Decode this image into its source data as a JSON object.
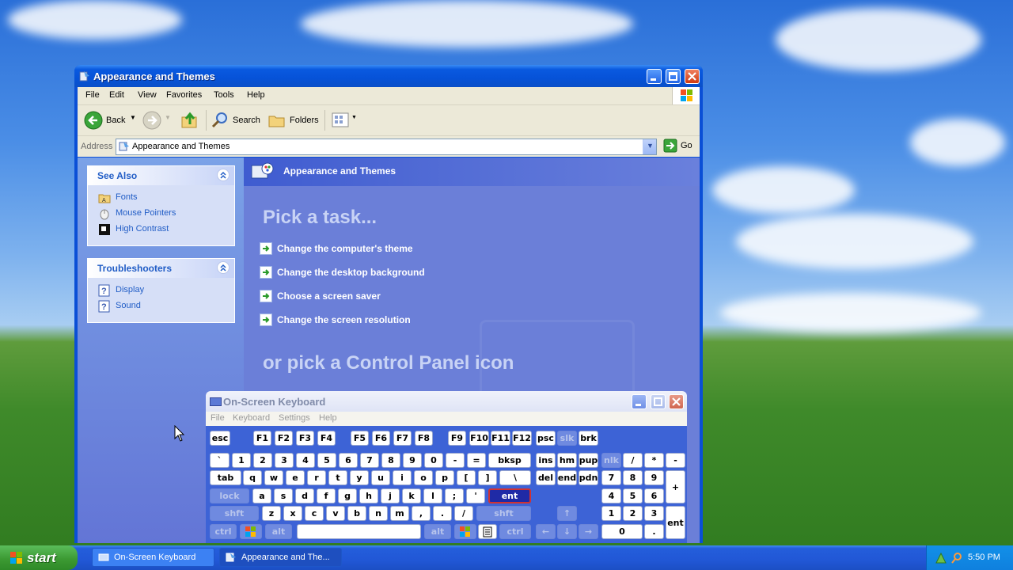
{
  "explorer": {
    "title": "Appearance and Themes",
    "menu": [
      "File",
      "Edit",
      "View",
      "Favorites",
      "Tools",
      "Help"
    ],
    "toolbar": {
      "back": "Back",
      "search": "Search",
      "folders": "Folders"
    },
    "address": {
      "label": "Address",
      "value": "Appearance and Themes",
      "go": "Go"
    },
    "see_also": {
      "title": "See Also",
      "items": [
        "Fonts",
        "Mouse Pointers",
        "High Contrast"
      ]
    },
    "troubleshooters": {
      "title": "Troubleshooters",
      "items": [
        "Display",
        "Sound"
      ]
    },
    "header": "Appearance and Themes",
    "pick_task": "Pick a task...",
    "tasks": [
      "Change the computer's theme",
      "Change the desktop background",
      "Choose a screen saver",
      "Change the screen resolution"
    ],
    "or_pick": "or pick a Control Panel icon"
  },
  "osk": {
    "title": "On-Screen Keyboard",
    "menu": [
      "File",
      "Keyboard",
      "Settings",
      "Help"
    ],
    "keys": {
      "esc": "esc",
      "f1": "F1",
      "f2": "F2",
      "f3": "F3",
      "f4": "F4",
      "f5": "F5",
      "f6": "F6",
      "f7": "F7",
      "f8": "F8",
      "f9": "F9",
      "f10": "F10",
      "f11": "F11",
      "f12": "F12",
      "psc": "psc",
      "slk": "slk",
      "brk": "brk",
      "backtick": "`",
      "n1": "1",
      "n2": "2",
      "n3": "3",
      "n4": "4",
      "n5": "5",
      "n6": "6",
      "n7": "7",
      "n8": "8",
      "n9": "9",
      "n0": "0",
      "minus": "-",
      "equals": "=",
      "bksp": "bksp",
      "ins": "ins",
      "hm": "hm",
      "pup": "pup",
      "nlk": "nlk",
      "np_slash": "/",
      "np_star": "*",
      "np_minus": "-",
      "tab": "tab",
      "q": "q",
      "w": "w",
      "e": "e",
      "r": "r",
      "t": "t",
      "y": "y",
      "u": "u",
      "i": "i",
      "o": "o",
      "p": "p",
      "lbracket": "[",
      "rbracket": "]",
      "backslash": "\\",
      "del": "del",
      "end": "end",
      "pdn": "pdn",
      "np7": "7",
      "np8": "8",
      "np9": "9",
      "np_plus": "+",
      "lock": "lock",
      "a": "a",
      "s": "s",
      "d": "d",
      "f": "f",
      "g": "g",
      "h": "h",
      "j": "j",
      "k": "k",
      "l": "l",
      "semicolon": ";",
      "quote": "'",
      "ent": "ent",
      "np4": "4",
      "np5": "5",
      "np6": "6",
      "lshft": "shft",
      "z": "z",
      "x": "x",
      "c": "c",
      "v": "v",
      "b": "b",
      "n": "n",
      "m": "m",
      "comma": ",",
      "period": ".",
      "slash": "/",
      "rshft": "shft",
      "up": "↑",
      "np1": "1",
      "np2": "2",
      "np3": "3",
      "np_ent": "ent",
      "lctrl": "ctrl",
      "lalt": "alt",
      "ralt": "alt",
      "rctrl": "ctrl",
      "left": "←",
      "down": "↓",
      "right": "→",
      "np0": "0",
      "np_dot": "."
    }
  },
  "taskbar": {
    "start": "start",
    "tasks": [
      "On-Screen Keyboard",
      "Appearance and The..."
    ],
    "clock": "5:50 PM"
  }
}
